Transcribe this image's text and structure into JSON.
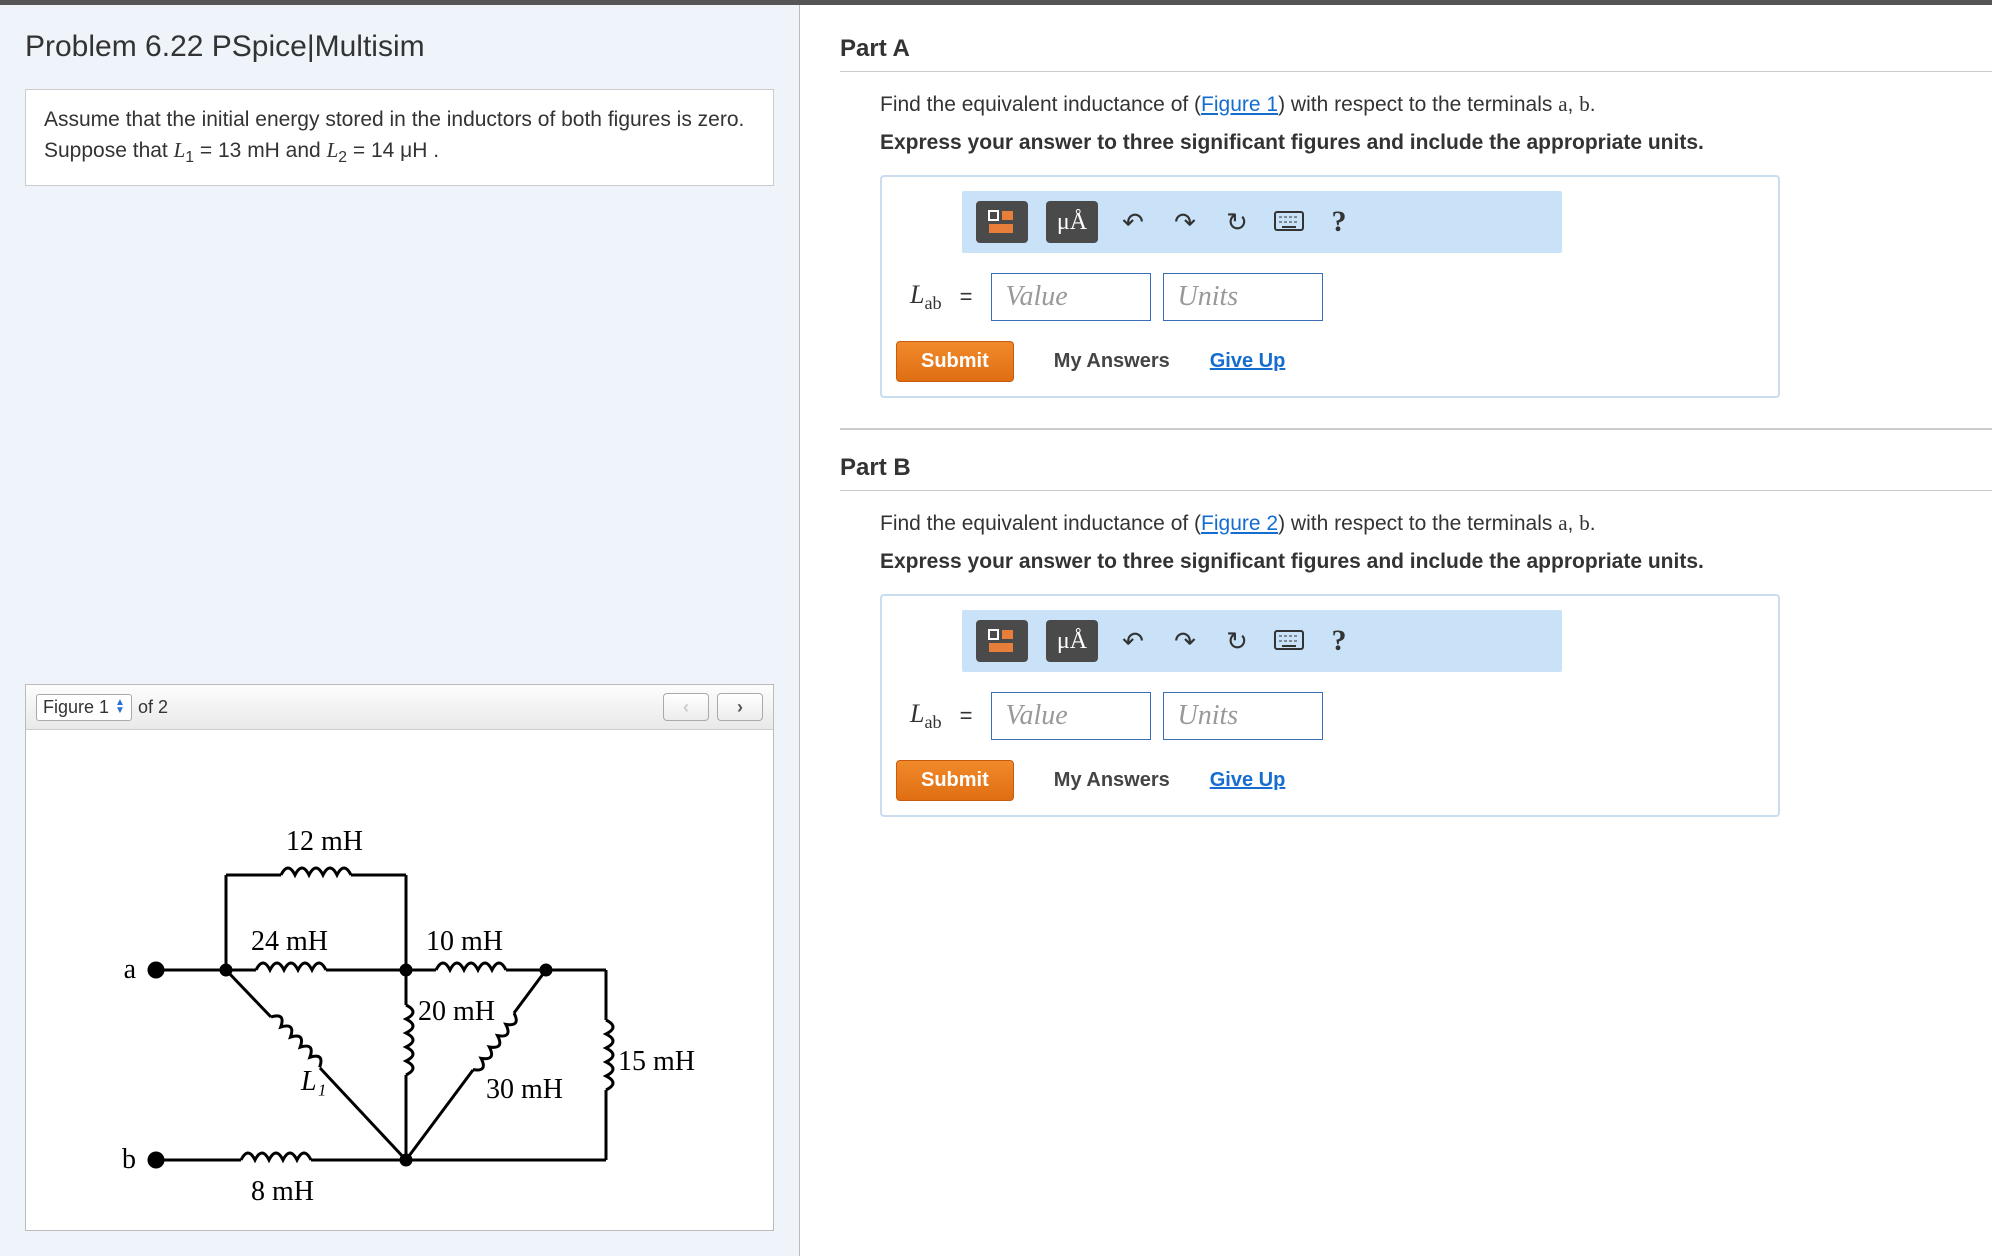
{
  "left": {
    "title": "Problem 6.22 PSpice|Multisim",
    "assume_pre": "Assume that the initial energy stored in the inductors of both figures is zero. Suppose that ",
    "L1_sym": "L",
    "L1_sub": "1",
    "L1_eq": " = 13  mH and ",
    "L2_sym": "L",
    "L2_sub": "2",
    "L2_eq": " = 14  μH .",
    "figure": {
      "selected": "Figure 1",
      "total": "of 2",
      "prev_label": "‹",
      "next_label": "›",
      "labels": {
        "v12": "12 mH",
        "v24": "24 mH",
        "v10": "10 mH",
        "v20": "20 mH",
        "v30": "30 mH",
        "v15": "15 mH",
        "v8": "8 mH",
        "L1": "L₁",
        "a": "a",
        "b": "b"
      }
    }
  },
  "partA": {
    "title": "Part A",
    "instr_pre": "Find the equivalent inductance of (",
    "fig_link": "Figure 1",
    "instr_post": ") with respect to the terminals ",
    "term_a": "a",
    "term_sep": ", ",
    "term_b": "b",
    "instr_end": ".",
    "instr2": "Express your answer to three significant figures and include the appropriate units.",
    "spec_label": "μÅ",
    "Lab_sym": "L",
    "Lab_sub": "ab",
    "eq": "=",
    "value_ph": "Value",
    "units_ph": "Units",
    "submit": "Submit",
    "myanswers": "My Answers",
    "giveup": "Give Up",
    "help": "?"
  },
  "partB": {
    "title": "Part B",
    "instr_pre": "Find the equivalent inductance of (",
    "fig_link": "Figure 2",
    "instr_post": ") with respect to the terminals ",
    "term_a": "a",
    "term_sep": ", ",
    "term_b": "b",
    "instr_end": ".",
    "instr2": "Express your answer to three significant figures and include the appropriate units.",
    "spec_label": "μÅ",
    "Lab_sym": "L",
    "Lab_sub": "ab",
    "eq": "=",
    "value_ph": "Value",
    "units_ph": "Units",
    "submit": "Submit",
    "myanswers": "My Answers",
    "giveup": "Give Up",
    "help": "?"
  }
}
